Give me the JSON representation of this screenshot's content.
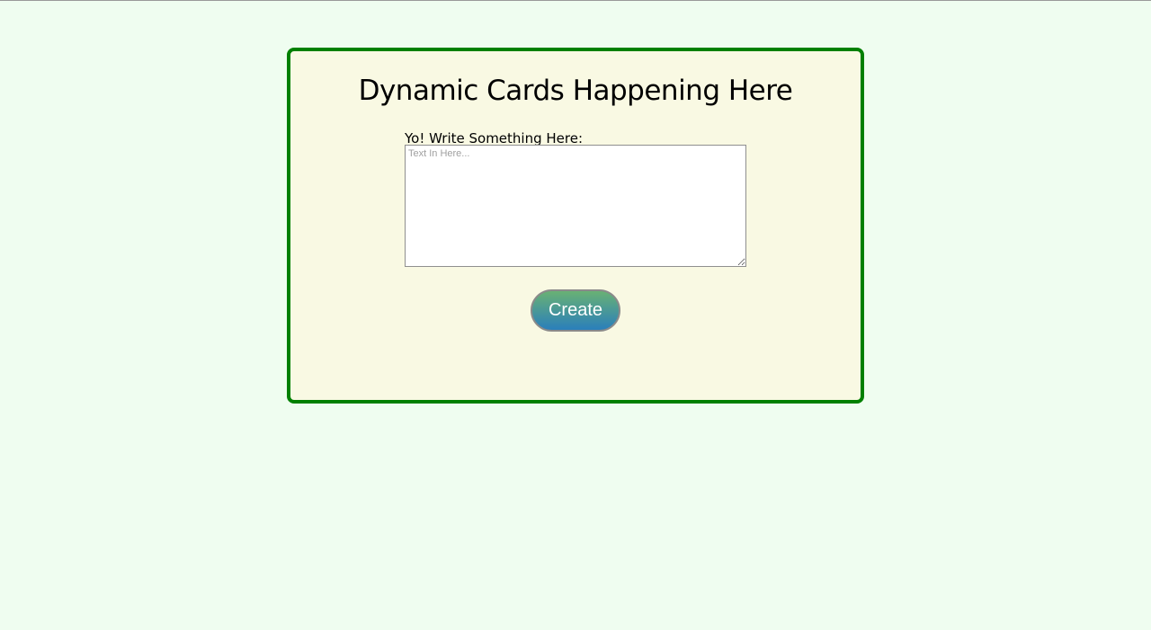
{
  "card": {
    "title": "Dynamic Cards Happening Here",
    "label": "Yo! Write Something Here:",
    "textarea": {
      "value": "",
      "placeholder": "Text In Here..."
    },
    "create_label": "Create"
  },
  "colors": {
    "border": "#008000",
    "card_bg": "#f9f9e3",
    "page_bg": "#effdf0"
  }
}
